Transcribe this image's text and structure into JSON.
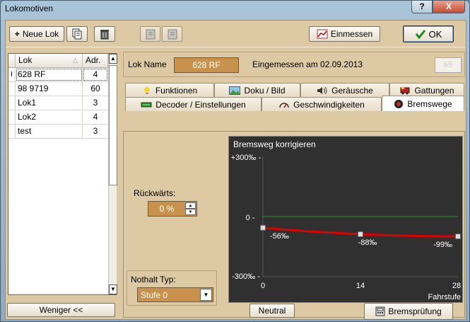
{
  "window": {
    "title": "Lokomotiven",
    "help": "?",
    "close": "X"
  },
  "toolbar": {
    "new_lok": "Neue Lok",
    "einmessen": "Einmessen",
    "ok": "OK"
  },
  "lok_table": {
    "headers": [
      "Lok",
      "Adr."
    ],
    "rows": [
      {
        "indicator": "I",
        "name": "628 RF",
        "adr": "4"
      },
      {
        "indicator": "",
        "name": "98 9719",
        "adr": "60"
      },
      {
        "indicator": "",
        "name": "Lok1",
        "adr": "3"
      },
      {
        "indicator": "",
        "name": "Lok2",
        "adr": "4"
      },
      {
        "indicator": "",
        "name": "test",
        "adr": "3"
      }
    ]
  },
  "weniger_label": "Weniger <<",
  "lok_name": {
    "label": "Lok Name",
    "value": "628 RF",
    "eingemessen": "Eingemessen am 02.09.2013",
    "small_box": "65"
  },
  "tabs_row1": [
    {
      "label": "Funktionen",
      "icon": "bulb-icon"
    },
    {
      "label": "Doku / Bild",
      "icon": "picture-icon"
    },
    {
      "label": "Geräusche",
      "icon": "speaker-icon"
    },
    {
      "label": "Gattungen",
      "icon": "train-icon"
    }
  ],
  "tabs_row2": [
    {
      "label": "Decoder / Einstellungen",
      "icon": "chip-icon"
    },
    {
      "label": "Geschwindigkeiten",
      "icon": "speedometer-icon"
    },
    {
      "label": "Bremswege",
      "icon": "brake-icon",
      "active": true
    }
  ],
  "rueckwaerts": {
    "label": "Rückwärts:",
    "value": "0 %"
  },
  "nothalt": {
    "label": "Nothalt Typ:",
    "value": "Stufe 0"
  },
  "neutral_label": "Neutral",
  "bremspruefung_label": "Bremsprüfung",
  "chart_data": {
    "type": "line",
    "title": "Bremsweg korrigieren",
    "xlabel": "Fahrstufe",
    "x_ticks": [
      "0",
      "14",
      "28"
    ],
    "y_ticks": [
      "+300‰ -",
      "0 -",
      "-300‰ -"
    ],
    "xlim": [
      0,
      28
    ],
    "ylim": [
      -300,
      300
    ],
    "points": [
      {
        "x": 0,
        "y": -56,
        "label": "-56‰"
      },
      {
        "x": 14,
        "y": -88,
        "label": "-88‰"
      },
      {
        "x": 28,
        "y": -99,
        "label": "-99‰"
      }
    ],
    "colors": {
      "line": "#e00000",
      "zero": "#2e8b2e",
      "bg": "#303030"
    }
  }
}
